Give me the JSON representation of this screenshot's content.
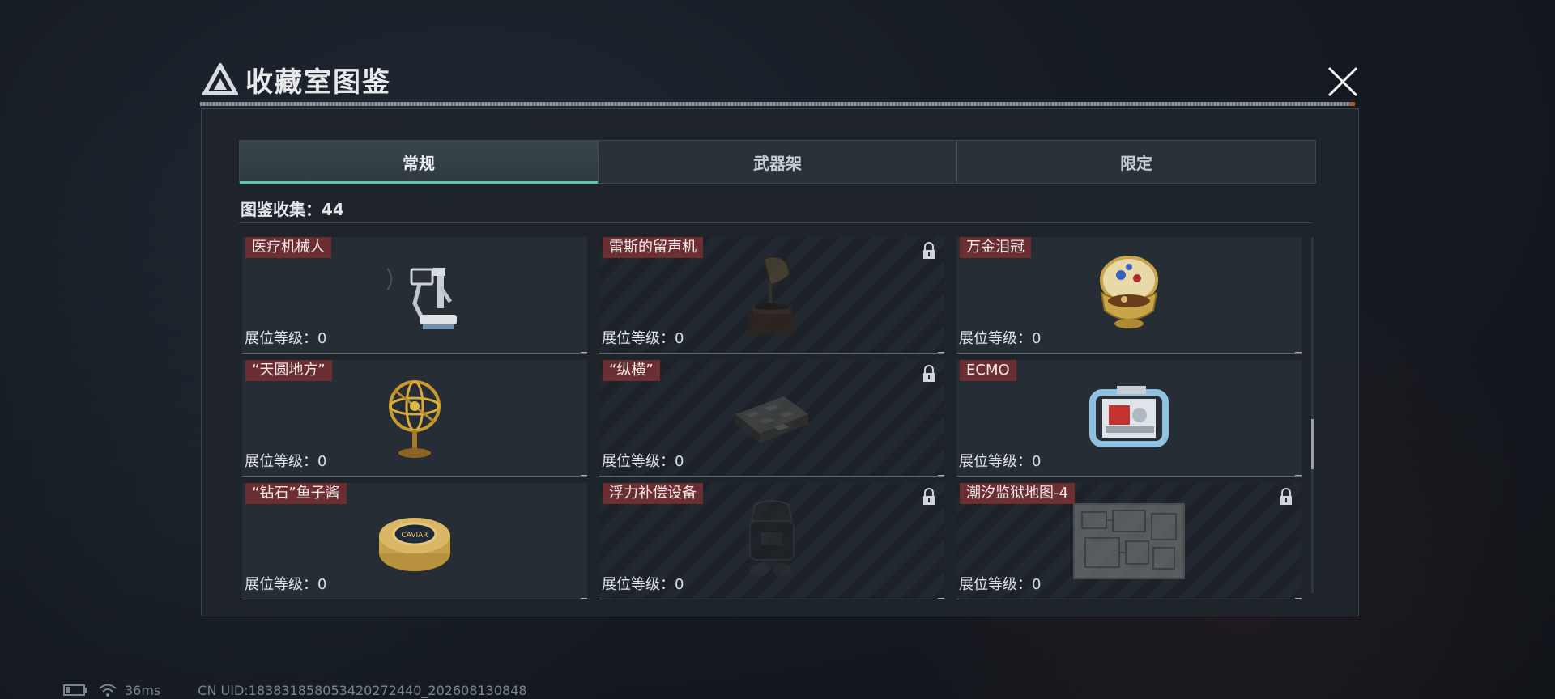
{
  "dialog": {
    "title": "收藏室图鉴"
  },
  "tabs": [
    {
      "label": "常规",
      "active": true
    },
    {
      "label": "武器架",
      "active": false
    },
    {
      "label": "限定",
      "active": false
    }
  ],
  "collection": {
    "label": "图鉴收集：44"
  },
  "items": [
    {
      "name": "医疗机械人",
      "level": "展位等级：0",
      "locked": false,
      "icon": "medical-robot-icon"
    },
    {
      "name": "雷斯的留声机",
      "level": "展位等级：0",
      "locked": true,
      "icon": "gramophone-icon"
    },
    {
      "name": "万金泪冠",
      "level": "展位等级：0",
      "locked": false,
      "icon": "jeweled-egg-icon"
    },
    {
      "name": "“天圆地方”",
      "level": "展位等级：0",
      "locked": false,
      "icon": "armillary-sphere-icon"
    },
    {
      "name": "“纵横”",
      "level": "展位等级：0",
      "locked": true,
      "icon": "chess-board-icon"
    },
    {
      "name": "ECMO",
      "level": "展位等级：0",
      "locked": false,
      "icon": "ecmo-machine-icon"
    },
    {
      "name": "“钻石”鱼子酱",
      "level": "展位等级：0",
      "locked": false,
      "icon": "caviar-tin-icon"
    },
    {
      "name": "浮力补偿设备",
      "level": "展位等级：0",
      "locked": true,
      "icon": "buoyancy-device-icon"
    },
    {
      "name": "潮汐监狱地图-4",
      "level": "展位等级：0",
      "locked": true,
      "icon": "prison-map-icon"
    }
  ],
  "status_bar": {
    "ping": "36ms",
    "uid": "CN UID:183831858053420272440_202608130848"
  },
  "colors": {
    "accent": "#58c9a7",
    "name_tag": "#6b2f33",
    "header_accent": "#c65b24"
  }
}
